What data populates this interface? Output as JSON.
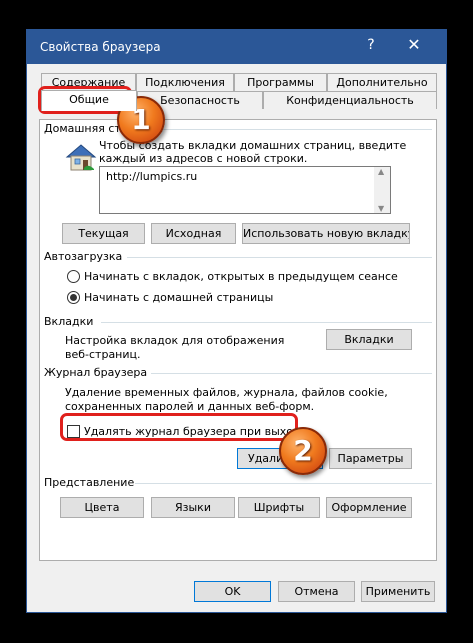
{
  "window": {
    "title": "Свойства браузера",
    "help": "?",
    "close": "✕"
  },
  "tabs": {
    "row1": [
      "Содержание",
      "Подключения",
      "Программы",
      "Дополнительно"
    ],
    "row2": [
      "Общие",
      "Безопасность",
      "Конфиденциальность"
    ]
  },
  "home": {
    "legend": "Домашняя страница",
    "description_line1": "Чтобы создать вкладки домашних страниц, введите",
    "description_line2": "каждый из адресов с новой строки.",
    "url": "http://lumpics.ru",
    "buttons": [
      "Текущая",
      "Исходная",
      "Использовать новую вкладку"
    ]
  },
  "startup": {
    "legend": "Автозагрузка",
    "options": [
      "Начинать с вкладок, открытых в предыдущем сеансе",
      "Начинать с домашней страницы"
    ],
    "selected": 1
  },
  "tabs_section": {
    "legend": "Вкладки",
    "description_line1": "Настройка вкладок для отображения",
    "description_line2": "веб-страниц.",
    "button": "Вкладки"
  },
  "history": {
    "legend": "Журнал браузера",
    "description_line1": "Удаление временных файлов, журнала, файлов cookie,",
    "description_line2": "сохраненных паролей и данных веб-форм.",
    "checkbox_label": "Удалять журнал браузера при выходе",
    "checked": false,
    "delete_button": "Удалить...",
    "settings_button": "Параметры"
  },
  "appearance": {
    "legend": "Представление",
    "buttons": [
      "Цвета",
      "Языки",
      "Шрифты",
      "Оформление"
    ]
  },
  "footer": {
    "ok": "OK",
    "cancel": "Отмена",
    "apply": "Применить"
  },
  "annotations": {
    "badge1": "1",
    "badge2": "2"
  },
  "colors": {
    "titlebar": "#2b5797",
    "highlight": "#e0201c",
    "badge": "#f07a1e"
  }
}
